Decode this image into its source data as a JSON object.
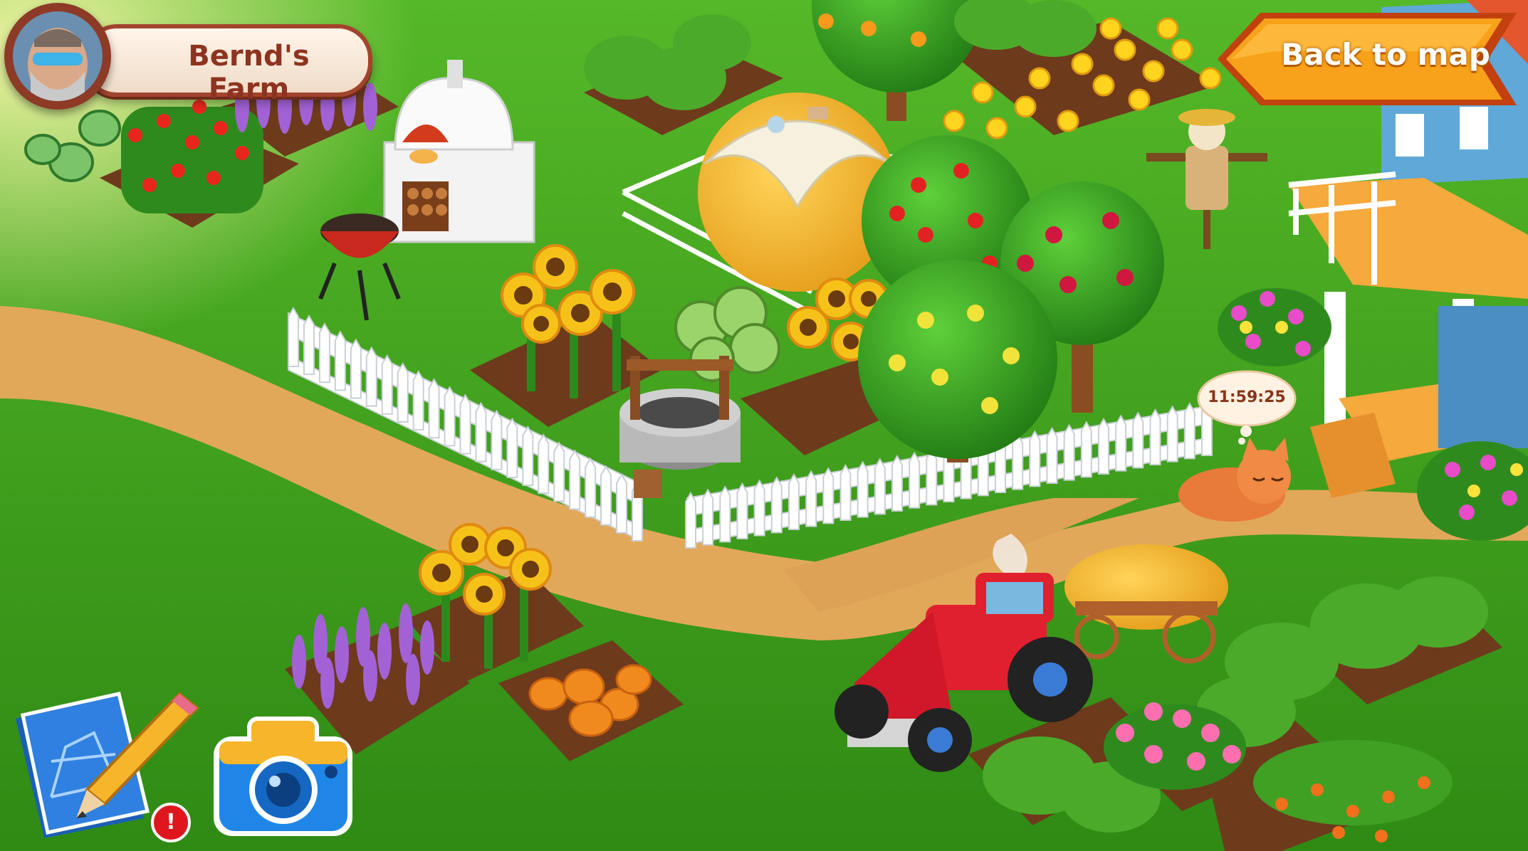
{
  "hud": {
    "farm_name": "Bernd's Farm",
    "back_button_label": "Back to map",
    "timer": "11:59:25",
    "design_icon": "blueprint-pencil-icon",
    "camera_icon": "camera-icon",
    "alert_icon": "exclamation-icon",
    "alert_glyph": "!"
  },
  "colors": {
    "grass": "#3f9e1b",
    "path": "#e2a85a",
    "soil": "#6d3a1c",
    "button_orange": "#f7a21a",
    "plate_border": "#a2442d",
    "tractor_red": "#e0202e"
  }
}
